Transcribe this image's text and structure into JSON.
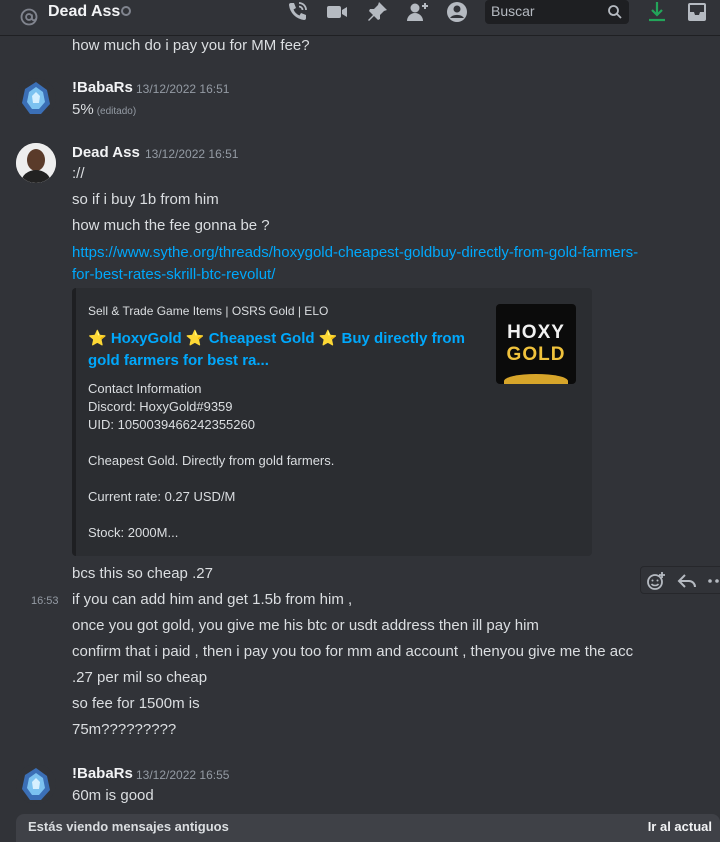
{
  "header": {
    "channel_name": "Dead Ass",
    "search_placeholder": "Buscar"
  },
  "messages": {
    "top_line": "how much do i pay you for MM fee?",
    "m1": {
      "author": "!BabaRs",
      "time": "13/12/2022 16:51",
      "text": "5%",
      "edited": "(editado)"
    },
    "m2": {
      "author": "Dead Ass",
      "time": "13/12/2022 16:51",
      "lines": [
        "://",
        "so if i buy 1b from him",
        "how much the fee gonna be ?"
      ],
      "link": "https://www.sythe.org/threads/hoxygold-cheapest-goldbuy-directly-from-gold-farmers-for-best-rates-skrill-btc-revolut/",
      "link_part1": "https://www.sythe.org/threads/hoxygold-cheapest-goldbuy-directly-from-gold-farmers-",
      "link_part2": "for-best-rates-skrill-btc-revolut/"
    },
    "embed": {
      "provider": "Sell & Trade Game Items | OSRS Gold | ELO",
      "title": "⭐ HoxyGold ⭐  Cheapest Gold ⭐ Buy directly from gold farmers for best ra...",
      "desc_lines": [
        "Contact Information",
        "Discord: HoxyGold#9359",
        "UID: 1050039466242355260",
        "Cheapest Gold. Directly from gold farmers.",
        "Current rate: 0.27 USD/M",
        "Stock: 2000M..."
      ],
      "thumb_line1": "HOXY",
      "thumb_line2": "GOLD"
    },
    "continued": {
      "first": "bcs this so cheap .27",
      "hover_time": "16:53",
      "lines": [
        "if you can add him and get 1.5b from him ,",
        "once you got gold, you give me his btc or usdt address then ill pay him",
        "confirm that i paid , then i pay you too for mm and account , thenyou give me the acc",
        ".27 per mil so cheap",
        "so fee for 1500m is",
        "75m?????????"
      ]
    },
    "m3": {
      "author": "!BabaRs",
      "time": "13/12/2022 16:55",
      "text": "60m is good"
    }
  },
  "footer": {
    "notice": "Estás viendo mensajes antiguos",
    "jump": "Ir al actual"
  },
  "colors": {
    "background": "#313338",
    "link": "#00a8fc",
    "embed_bg": "#2b2d31",
    "download_green": "#23a55a"
  }
}
